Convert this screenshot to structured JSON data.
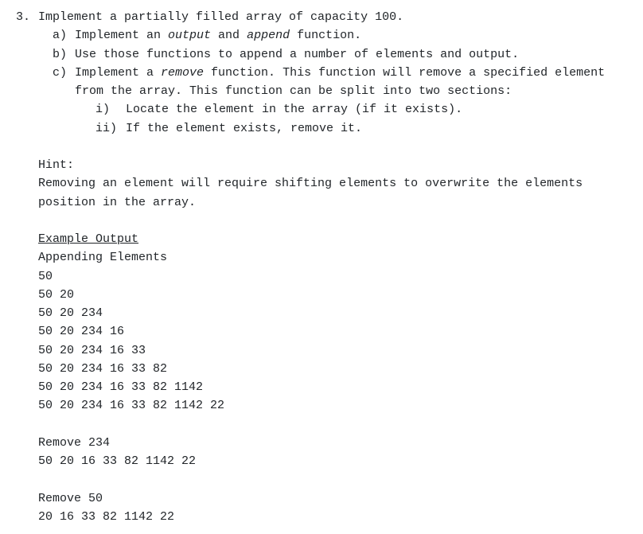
{
  "question": {
    "number": "3.",
    "prompt_pre": "Implement a partially filled array of capacity 100.",
    "subs": [
      {
        "label": "a)",
        "text_pre": "Implement an ",
        "italic1": "output",
        "text_mid": " and ",
        "italic2": "append",
        "text_post": " function."
      },
      {
        "label": "b)",
        "text": "Use those functions to append a number of elements and output."
      },
      {
        "label": "c)",
        "text_pre": "Implement a ",
        "italic1": "remove",
        "text_post": " function. This function will remove a specified element from the array. This function can be split into two sections:",
        "subsubs": [
          {
            "label": "i)",
            "text": "Locate the element in the array (if it exists)."
          },
          {
            "label": "ii)",
            "text": "If the element exists, remove it."
          }
        ]
      }
    ]
  },
  "hint": {
    "heading": "Hint:",
    "text": "Removing an element will require shifting elements to overwrite the elements position in the array."
  },
  "example": {
    "heading": "Example Output",
    "section1_title": "Appending Elements",
    "appends": [
      "50",
      "50 20",
      "50 20 234",
      "50 20 234 16",
      "50 20 234 16 33",
      "50 20 234 16 33 82",
      "50 20 234 16 33 82 1142",
      "50 20 234 16 33 82 1142 22"
    ],
    "remove1_title": "Remove 234",
    "remove1_result": "50 20 16 33 82 1142 22",
    "remove2_title": "Remove 50",
    "remove2_result": "20 16 33 82 1142 22"
  }
}
